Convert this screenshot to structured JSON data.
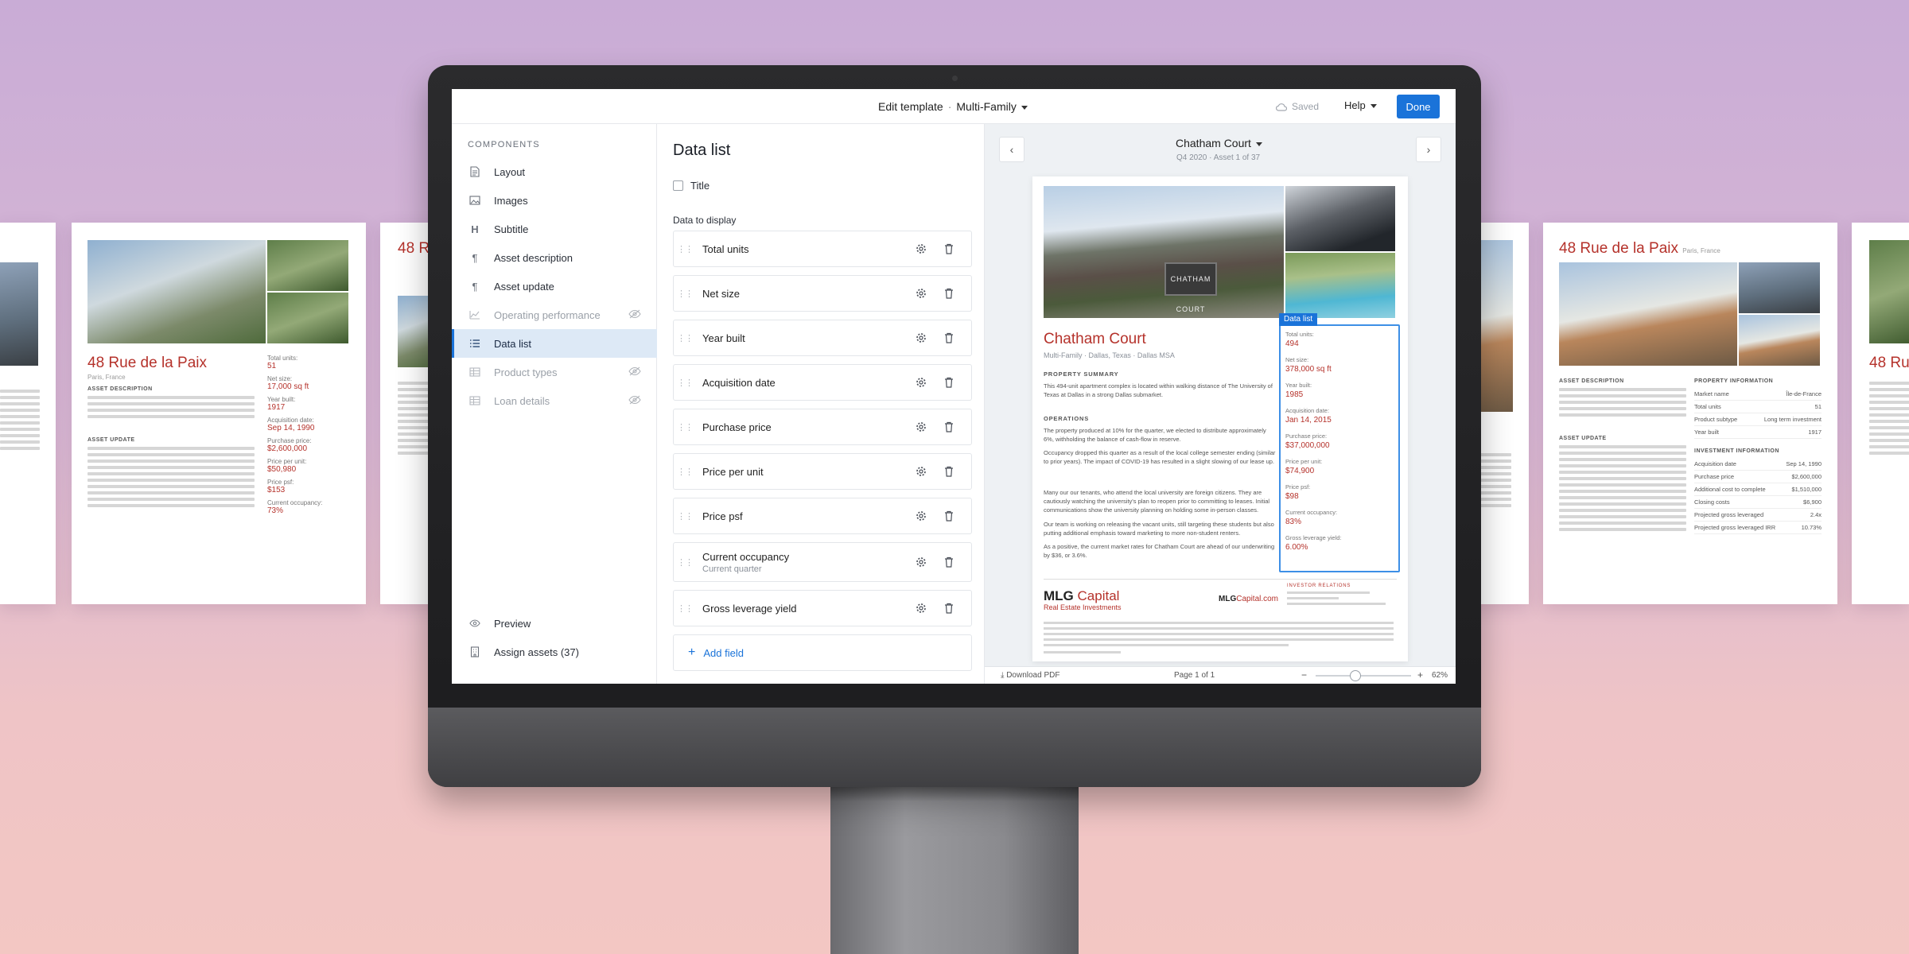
{
  "header": {
    "crumb_main": "Edit template",
    "crumb_sep": "·",
    "template_name": "Multi-Family",
    "saved": "Saved",
    "help": "Help",
    "done": "Done"
  },
  "components": {
    "heading": "COMPONENTS",
    "items": [
      {
        "label": "Layout"
      },
      {
        "label": "Images"
      },
      {
        "label": "Subtitle"
      },
      {
        "label": "Asset description"
      },
      {
        "label": "Asset update"
      },
      {
        "label": "Operating performance"
      },
      {
        "label": "Data list"
      },
      {
        "label": "Product types"
      },
      {
        "label": "Loan details"
      }
    ],
    "preview": "Preview",
    "assign": "Assign assets (37)"
  },
  "datalist": {
    "title": "Data list",
    "title_checkbox": "Title",
    "section_label": "Data to display",
    "fields": [
      {
        "label": "Total units"
      },
      {
        "label": "Net size"
      },
      {
        "label": "Year built"
      },
      {
        "label": "Acquisition date"
      },
      {
        "label": "Purchase price"
      },
      {
        "label": "Price per unit"
      },
      {
        "label": "Price psf"
      },
      {
        "label": "Current occupancy",
        "sub": "Current quarter"
      },
      {
        "label": "Gross leverage yield"
      }
    ],
    "add_field": "Add field"
  },
  "preview": {
    "asset_name": "Chatham Court",
    "period": "Q4 2020",
    "asset_count": "Asset 1 of 37",
    "sheet": {
      "sign": "CHATHAM COURT",
      "title": "Chatham Court",
      "subtitle": "Multi-Family · Dallas, Texas · Dallas MSA",
      "summary_h": "PROPERTY SUMMARY",
      "summary": "This 494-unit apartment complex is located within walking distance of The University of Texas at Dallas in a strong Dallas submarket.",
      "ops_h": "OPERATIONS",
      "ops_1": "The property produced at 10% for the quarter, we elected to distribute approximately 6%, withholding the balance of cash-flow in reserve.",
      "ops_2": "Occupancy dropped this quarter as a result of the local college semester ending (similar to prior years). The impact of COVID-19 has resulted in a slight slowing of our lease up.",
      "ops_3": "Many our our tenants, who attend the local university are foreign citizens. They are cautiously watching the university's plan to reopen prior to committing to leases. Initial communications show the university planning on holding some in-person classes.",
      "ops_4": "Our team is working on releasing the vacant units, still targeting these students but also putting additional emphasis toward marketing to more non-student renters.",
      "ops_5": "As a positive, the current market rates for Chatham Court are ahead of our underwriting by $36, or 3.6%.",
      "datalist_tag": "Data list",
      "stats": [
        {
          "label": "Total units:",
          "value": "494"
        },
        {
          "label": "Net size:",
          "value": "378,000 sq ft"
        },
        {
          "label": "Year built:",
          "value": "1985"
        },
        {
          "label": "Acquisition date:",
          "value": "Jan 14, 2015"
        },
        {
          "label": "Purchase price:",
          "value": "$37,000,000"
        },
        {
          "label": "Price per unit:",
          "value": "$74,900"
        },
        {
          "label": "Price psf:",
          "value": "$98"
        },
        {
          "label": "Current occupancy:",
          "value": "83%"
        },
        {
          "label": "Gross leverage yield:",
          "value": "6.00%"
        }
      ],
      "brand_1": "MLG",
      "brand_2": "Capital",
      "brand_sub": "Real Estate Investments",
      "url_1": "MLG",
      "url_2": "Capital.com",
      "ir_h": "INVESTOR RELATIONS"
    },
    "download": "Download PDF",
    "page": "Page 1 of 1",
    "zoom_minus": "−",
    "zoom_plus": "+",
    "zoom": "62%",
    "zoom_level": 0.42
  },
  "background_pages": {
    "left_title": "48 Rue de la Paix",
    "left_sub": "Paris, France",
    "left_partial_title": "48 Ru",
    "asset_desc_h": "ASSET DESCRIPTION",
    "asset_update_h": "ASSET UPDATE",
    "left_stats": [
      {
        "label": "Total units:",
        "value": "51"
      },
      {
        "label": "Net size:",
        "value": "17,000 sq ft"
      },
      {
        "label": "Year built:",
        "value": "1917"
      },
      {
        "label": "Acquisition date:",
        "value": "Sep 14, 1990"
      },
      {
        "label": "Purchase price:",
        "value": "$2,600,000"
      },
      {
        "label": "Price per unit:",
        "value": "$50,980"
      },
      {
        "label": "Price psf:",
        "value": "$153"
      },
      {
        "label": "Current occupancy:",
        "value": "73%"
      }
    ],
    "right_title": "48 Rue de la Paix",
    "right_sub": "Paris, France",
    "right_partial_title": "48 Rue",
    "prop_info_h": "PROPERTY INFORMATION",
    "prop_info": [
      {
        "k": "Market name",
        "v": "Île-de-France"
      },
      {
        "k": "Total units",
        "v": "51"
      },
      {
        "k": "Product subtype",
        "v": "Long term investment"
      },
      {
        "k": "Year built",
        "v": "1917"
      }
    ],
    "inv_info_h": "INVESTMENT INFORMATION",
    "inv_info": [
      {
        "k": "Acquisition date",
        "v": "Sep 14, 1990"
      },
      {
        "k": "Purchase price",
        "v": "$2,600,000"
      },
      {
        "k": "Additional cost to complete",
        "v": "$1,510,000"
      },
      {
        "k": "Closing costs",
        "v": "$6,900"
      },
      {
        "k": "Projected gross leveraged",
        "v": "2.4x"
      },
      {
        "k": "Projected gross leveraged IRR",
        "v": "10.73%"
      }
    ]
  }
}
